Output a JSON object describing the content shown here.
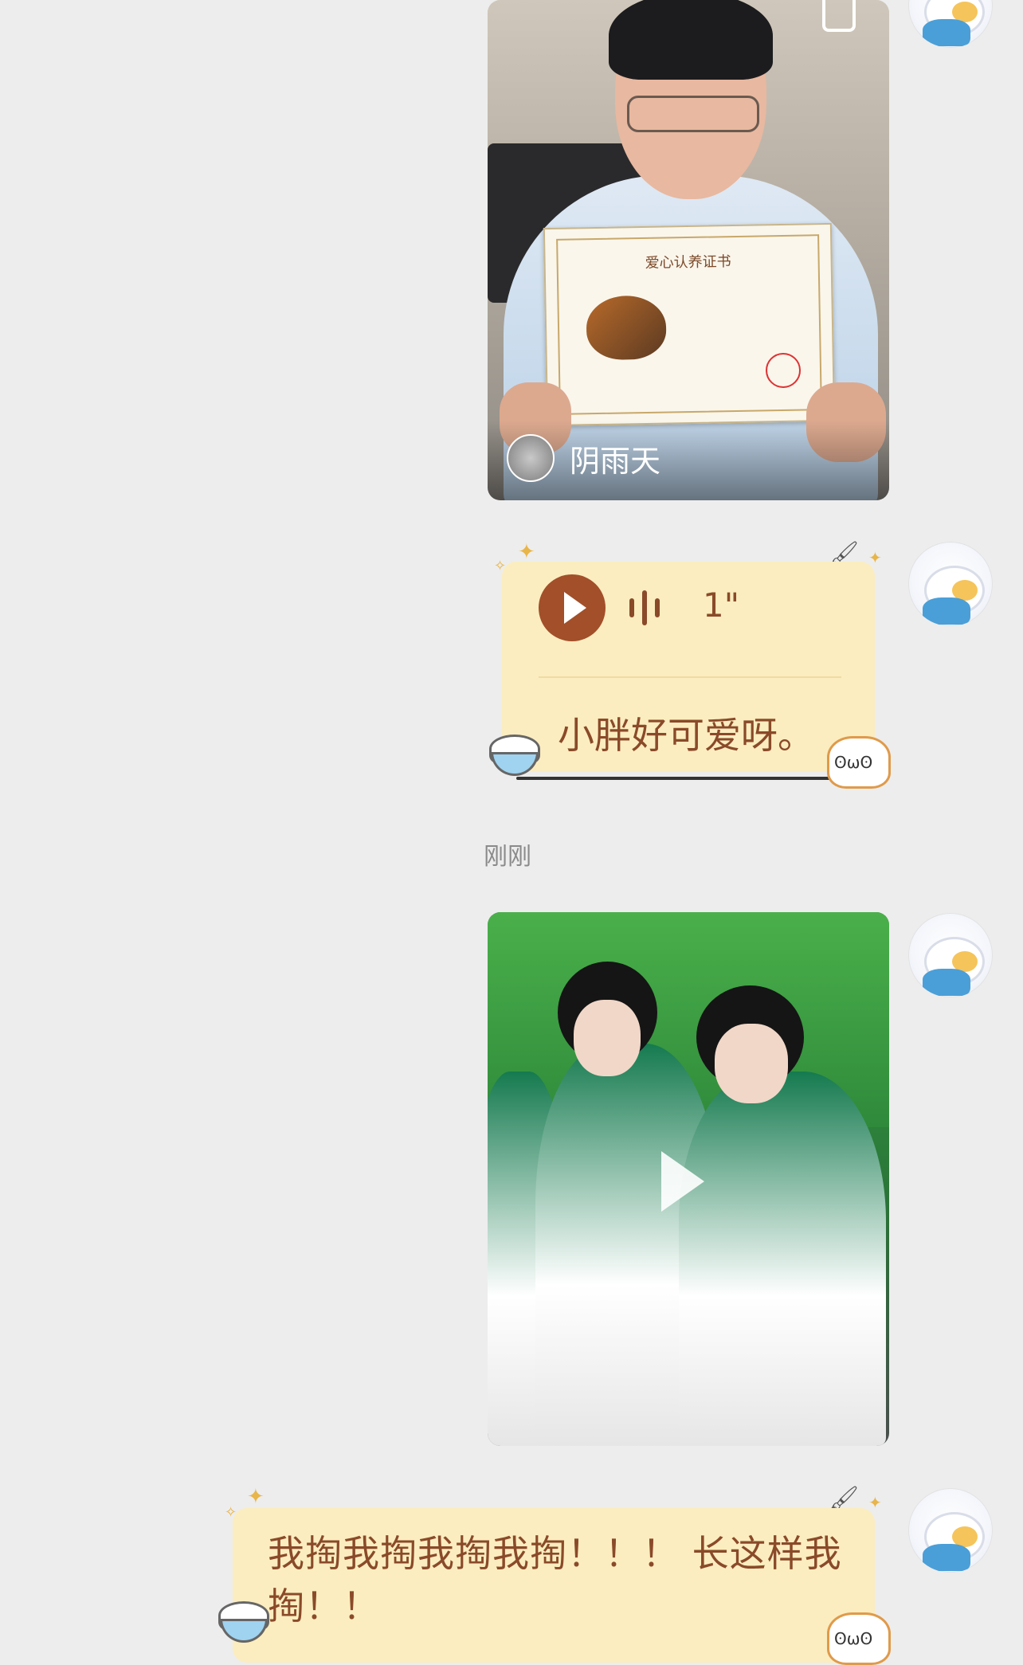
{
  "messages": [
    {
      "type": "image",
      "caption_name": "阴雨天"
    },
    {
      "type": "voice",
      "duration": "1\"",
      "transcript": "小胖好可爱呀。"
    },
    {
      "type": "timestamp",
      "text": "刚刚"
    },
    {
      "type": "video"
    },
    {
      "type": "text",
      "text": "我掏我掏我掏我掏！！！ 长这样我掏！！"
    }
  ],
  "certificate": {
    "title": "爱心认养证书"
  },
  "colors": {
    "bubble": "#fbedbf",
    "text": "#8a4a2a",
    "play": "#a24f2a",
    "background": "#ededed"
  },
  "icons": [
    "copy-icon",
    "play-icon",
    "voice-wave-icon",
    "rice-bowl-icon",
    "cat-sticker-icon",
    "sparkle-icon",
    "brush-icon"
  ]
}
